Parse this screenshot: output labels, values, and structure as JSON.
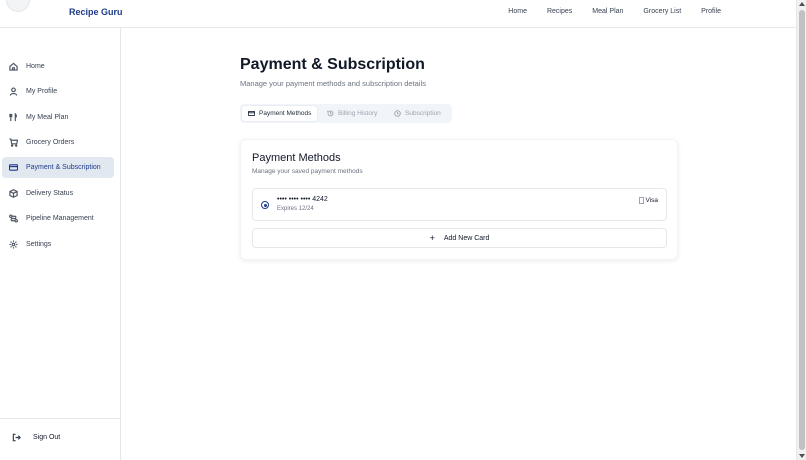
{
  "app": {
    "brand": "Recipe Guru"
  },
  "topnav": {
    "items": [
      "Home",
      "Recipes",
      "Meal Plan",
      "Grocery List",
      "Profile"
    ]
  },
  "sidebar": {
    "items": [
      {
        "label": "Home",
        "icon": "home-icon"
      },
      {
        "label": "My Profile",
        "icon": "user-icon"
      },
      {
        "label": "My Meal Plan",
        "icon": "utensils-icon"
      },
      {
        "label": "Grocery Orders",
        "icon": "cart-icon"
      },
      {
        "label": "Payment & Subscription",
        "icon": "credit-card-icon",
        "active": true
      },
      {
        "label": "Delivery Status",
        "icon": "package-icon"
      },
      {
        "label": "Pipeline Management",
        "icon": "route-icon"
      },
      {
        "label": "Settings",
        "icon": "gear-icon"
      }
    ],
    "signout": "Sign Out"
  },
  "main": {
    "title": "Payment & Subscription",
    "subtitle": "Manage your payment methods and subscription details",
    "tabs": [
      {
        "label": "Payment Methods",
        "active": true
      },
      {
        "label": "Billing History"
      },
      {
        "label": "Subscription"
      }
    ],
    "card": {
      "title": "Payment Methods",
      "subtitle": "Manage your saved payment methods",
      "method": {
        "number": "•••• •••• •••• 4242",
        "expires": "Expires 12/24",
        "brand_alt": "Visa",
        "selected": true
      },
      "add_label": "Add New Card"
    }
  },
  "colors": {
    "accent": "#1e3a8a",
    "active_bg": "#e2e8f0"
  }
}
